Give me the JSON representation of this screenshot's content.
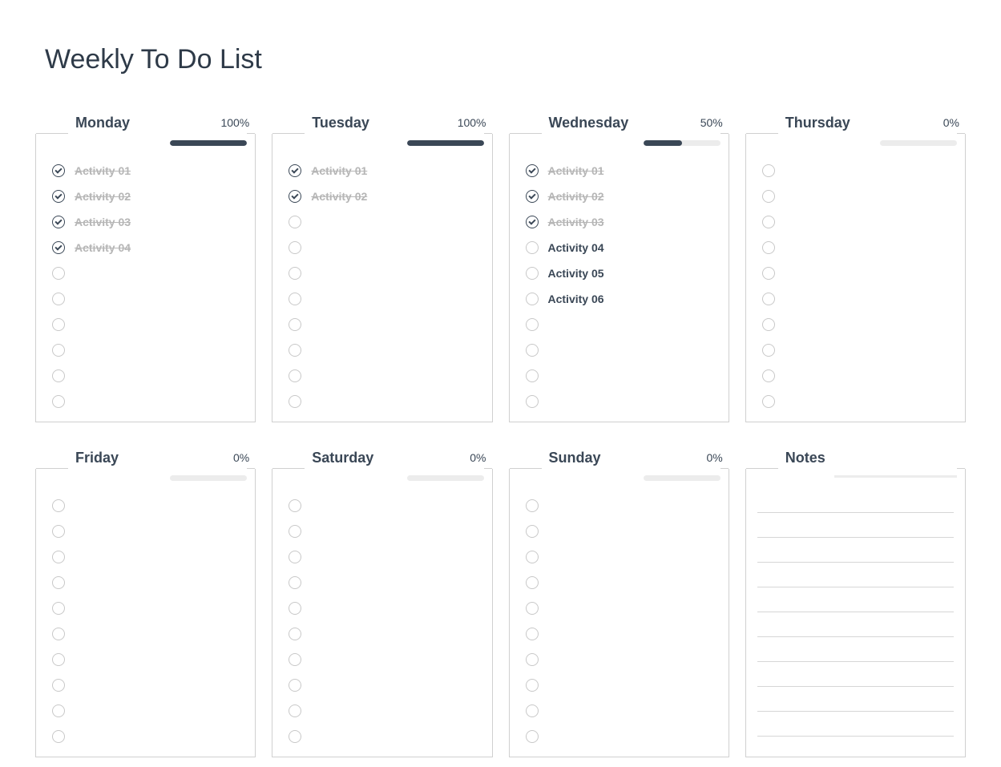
{
  "title": "Weekly To Do List",
  "notes_title": "Notes",
  "empty_count": 10,
  "note_lines": 10,
  "days": [
    {
      "name": "Monday",
      "pct": "100%",
      "progress": 100,
      "items": [
        {
          "label": "Activity 01",
          "done": true
        },
        {
          "label": "Activity 02",
          "done": true
        },
        {
          "label": "Activity 03",
          "done": true
        },
        {
          "label": "Activity 04",
          "done": true
        }
      ]
    },
    {
      "name": "Tuesday",
      "pct": "100%",
      "progress": 100,
      "items": [
        {
          "label": "Activity 01",
          "done": true
        },
        {
          "label": "Activity 02",
          "done": true
        }
      ]
    },
    {
      "name": "Wednesday",
      "pct": "50%",
      "progress": 50,
      "items": [
        {
          "label": "Activity 01",
          "done": true
        },
        {
          "label": "Activity 02",
          "done": true
        },
        {
          "label": "Activity 03",
          "done": true
        },
        {
          "label": "Activity 04",
          "done": false
        },
        {
          "label": "Activity 05",
          "done": false
        },
        {
          "label": "Activity 06",
          "done": false
        }
      ]
    },
    {
      "name": "Thursday",
      "pct": "0%",
      "progress": 0,
      "items": []
    },
    {
      "name": "Friday",
      "pct": "0%",
      "progress": 0,
      "items": []
    },
    {
      "name": "Saturday",
      "pct": "0%",
      "progress": 0,
      "items": []
    },
    {
      "name": "Sunday",
      "pct": "0%",
      "progress": 0,
      "items": []
    }
  ]
}
